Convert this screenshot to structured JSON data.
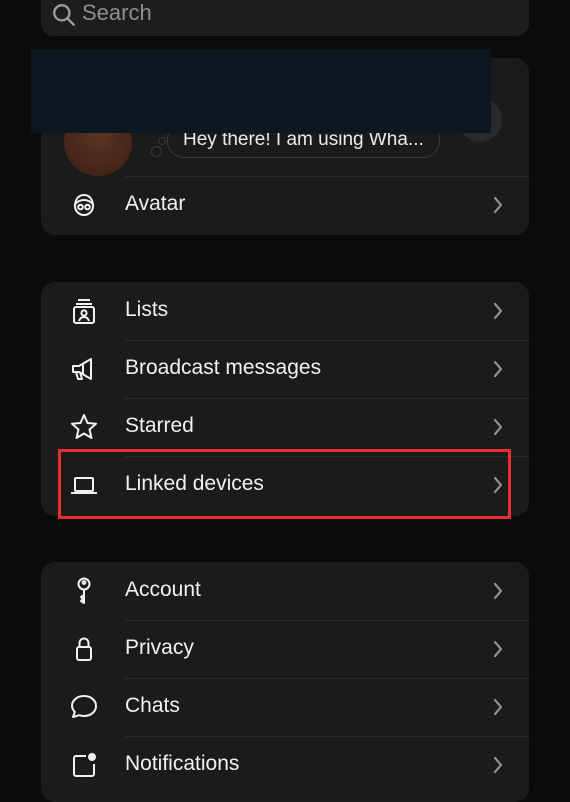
{
  "search": {
    "placeholder": "Search",
    "icon": "search-icon"
  },
  "profile": {
    "status": "Hey there! I am using Wha..."
  },
  "group1": [
    {
      "label": "Avatar",
      "icon": "avatar-icon"
    }
  ],
  "group2": [
    {
      "label": "Lists",
      "icon": "lists-icon"
    },
    {
      "label": "Broadcast messages",
      "icon": "megaphone-icon"
    },
    {
      "label": "Starred",
      "icon": "star-icon"
    },
    {
      "label": "Linked devices",
      "icon": "laptop-icon"
    }
  ],
  "group3": [
    {
      "label": "Account",
      "icon": "key-icon"
    },
    {
      "label": "Privacy",
      "icon": "lock-icon"
    },
    {
      "label": "Chats",
      "icon": "chat-bubble-icon"
    },
    {
      "label": "Notifications",
      "icon": "notification-icon"
    }
  ],
  "colors": {
    "background": "#0b0b0b",
    "card": "#1b1b1c",
    "highlight": "#e4312f"
  }
}
